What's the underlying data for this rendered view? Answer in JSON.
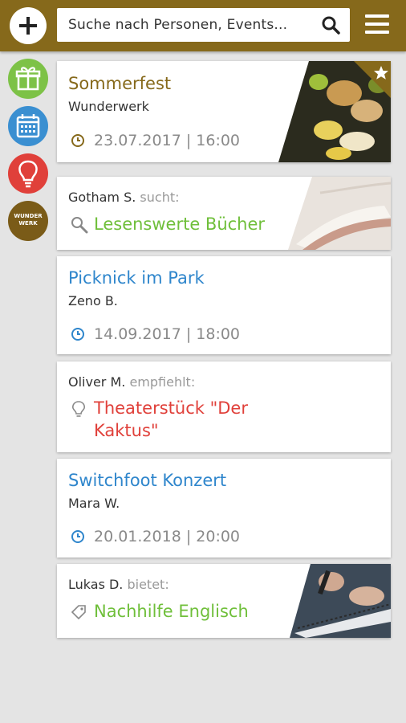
{
  "header": {
    "search_placeholder": "Suche nach Personen, Events...",
    "bar_color": "#86691b"
  },
  "sidebar": {
    "items": [
      {
        "icon": "gift-icon",
        "color": "#7dc247"
      },
      {
        "icon": "calendar-icon",
        "color": "#3a8fd1"
      },
      {
        "icon": "lightbulb-icon",
        "color": "#e0403a"
      },
      {
        "icon": "wunderwerk-logo",
        "label": "WUNDER WERK"
      }
    ]
  },
  "feed": [
    {
      "type": "event",
      "title": "Sommerfest",
      "host": "Wunderwerk",
      "date": "23.07.2017 | 16:00",
      "featured": true
    },
    {
      "type": "search",
      "user": "Gotham S.",
      "verb": "sucht:",
      "item": "Lesenswerte Bücher"
    },
    {
      "type": "event",
      "title": "Picknick im Park",
      "host": "Zeno B.",
      "date": "14.09.2017 | 18:00"
    },
    {
      "type": "recommend",
      "user": "Oliver M.",
      "verb": "empfiehlt:",
      "item": "Theaterstück \"Der Kaktus\""
    },
    {
      "type": "event",
      "title": "Switchfoot Konzert",
      "host": "Mara W.",
      "date": "20.01.2018 | 20:00"
    },
    {
      "type": "offer",
      "user": "Lukas D.",
      "verb": "bietet:",
      "item": "Nachhilfe Englisch"
    }
  ]
}
